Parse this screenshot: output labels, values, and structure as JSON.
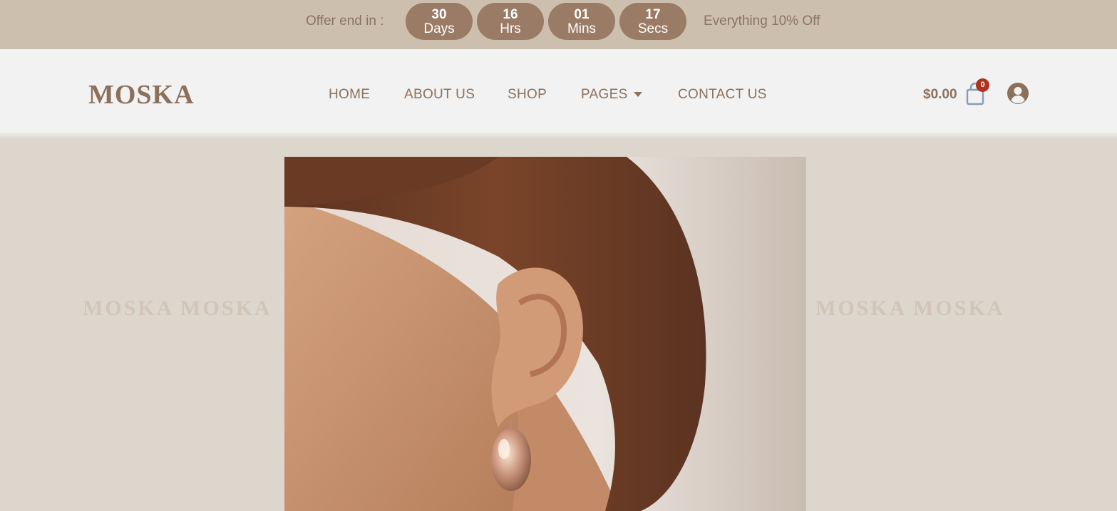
{
  "topbar": {
    "offer_label": "Offer end in :",
    "countdown": [
      {
        "value": "30",
        "unit": "Days"
      },
      {
        "value": "16",
        "unit": "Hrs"
      },
      {
        "value": "01",
        "unit": "Mins"
      },
      {
        "value": "17",
        "unit": "Secs"
      }
    ],
    "offer_text": "Everything 10% Off"
  },
  "header": {
    "logo": "MOSKA",
    "nav": [
      {
        "label": "HOME"
      },
      {
        "label": "ABOUT US"
      },
      {
        "label": "SHOP"
      },
      {
        "label": "PAGES",
        "has_dropdown": true
      },
      {
        "label": "CONTACT US"
      }
    ],
    "cart_total": "$0.00",
    "cart_count": "0",
    "icons": {
      "cart": "shopping-bag-icon",
      "account": "user-circle-icon",
      "dropdown": "caret-down-icon"
    }
  },
  "hero": {
    "watermark_left": "MOSKA MOSKA",
    "watermark_right": "MOSKA MOSKA",
    "image_alt": "Close-up of a woman's ear wearing a gold teardrop earring"
  },
  "colors": {
    "topbar_bg": "#cdbfae",
    "pill_bg": "#9a7b66",
    "brand": "#8b705c",
    "header_bg": "#f2f2f2",
    "page_bg": "#ddd6cd",
    "badge": "#b0321e"
  }
}
